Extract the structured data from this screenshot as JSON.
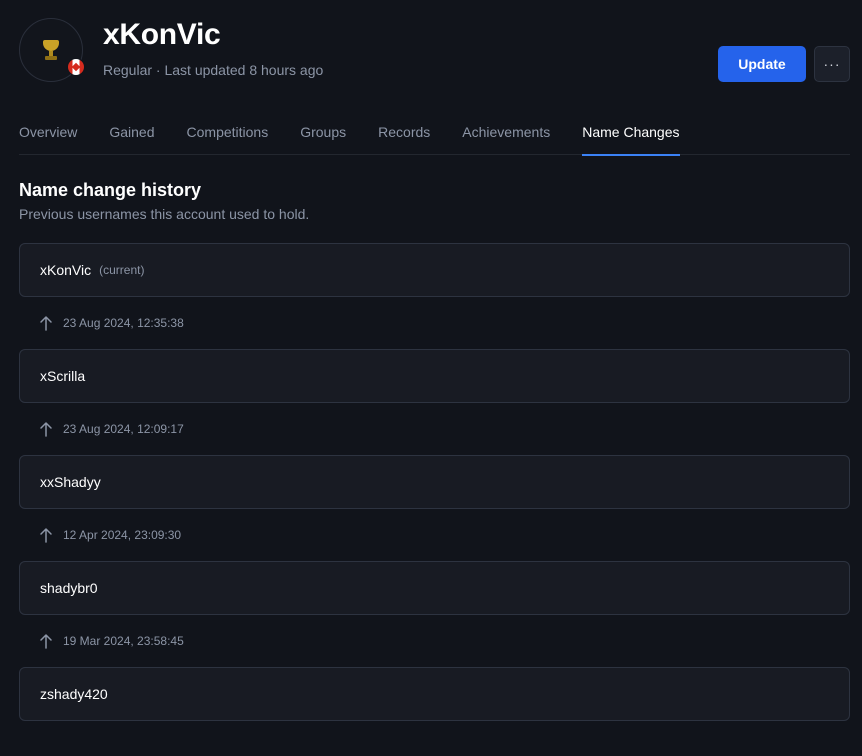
{
  "header": {
    "player_name": "xKonVic",
    "subtitle": "Regular · Last updated 8 hours ago",
    "avatar_icon": "trophy-icon",
    "country_flag": "canada-flag-icon",
    "update_label": "Update",
    "more_label": "···"
  },
  "tabs": [
    {
      "label": "Overview",
      "active": false
    },
    {
      "label": "Gained",
      "active": false
    },
    {
      "label": "Competitions",
      "active": false
    },
    {
      "label": "Groups",
      "active": false
    },
    {
      "label": "Records",
      "active": false
    },
    {
      "label": "Achievements",
      "active": false
    },
    {
      "label": "Name Changes",
      "active": true
    }
  ],
  "section": {
    "title": "Name change history",
    "description": "Previous usernames this account used to hold."
  },
  "names": [
    {
      "name": "xKonVic",
      "tag": "(current)"
    },
    {
      "name": "xScrilla"
    },
    {
      "name": "xxShadyy"
    },
    {
      "name": "shadybr0"
    },
    {
      "name": "zshady420"
    }
  ],
  "changes": [
    {
      "date": "23 Aug 2024, 12:35:38"
    },
    {
      "date": "23 Aug 2024, 12:09:17"
    },
    {
      "date": "12 Apr 2024, 23:09:30"
    },
    {
      "date": "19 Mar 2024, 23:58:45"
    }
  ],
  "colors": {
    "accent": "#2563eb",
    "tab_underline": "#3b82f6",
    "background": "#11141b",
    "card": "#181b23",
    "muted_text": "#8c95a6"
  }
}
